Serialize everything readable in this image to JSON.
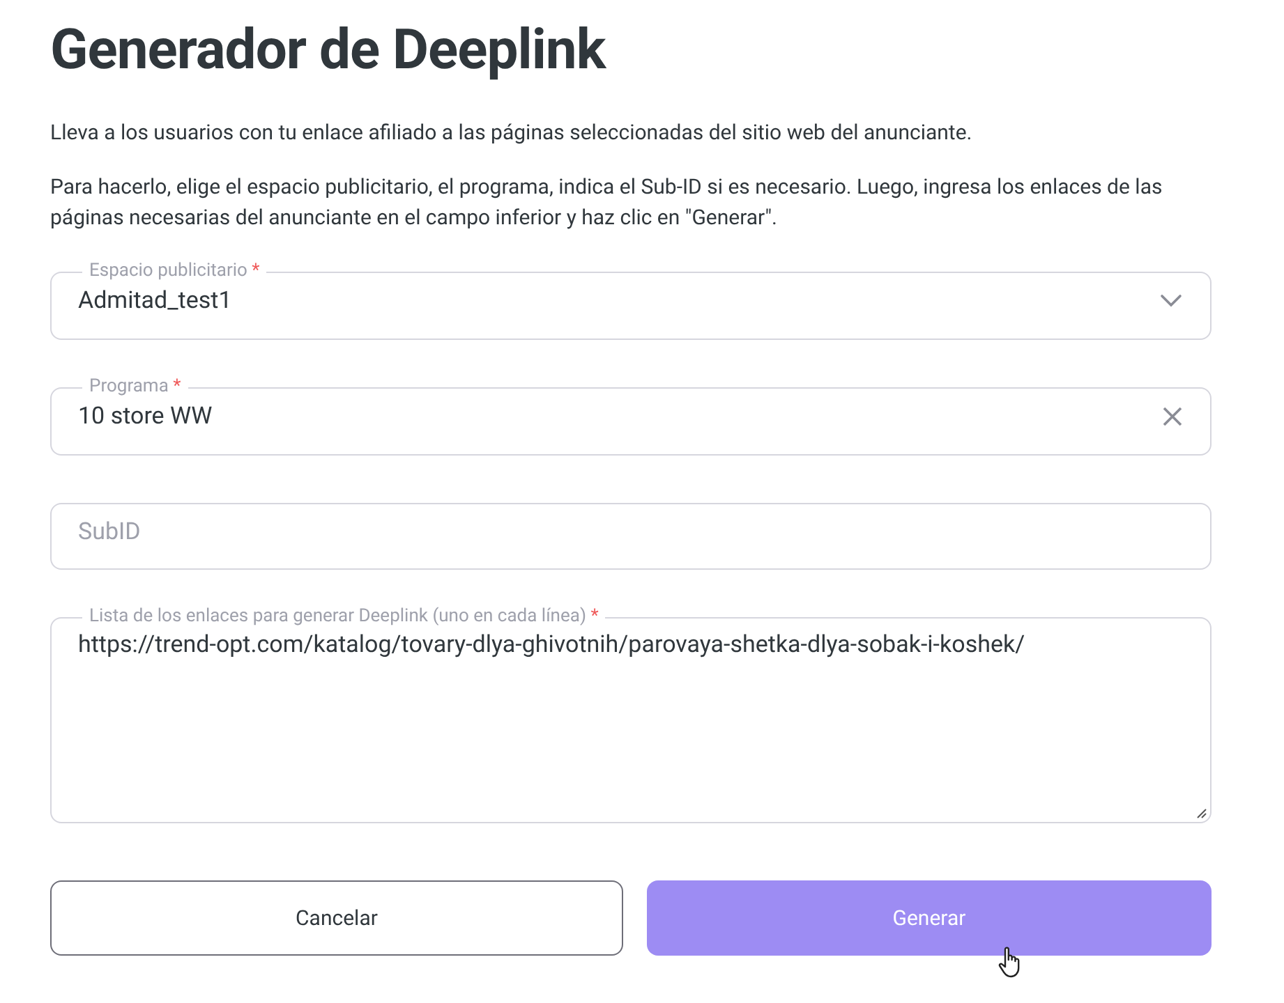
{
  "title": "Generador de Deeplink",
  "paragraphs": [
    "Lleva a los usuarios con tu enlace afiliado a las páginas seleccionadas del sitio web del anunciante.",
    "Para hacerlo, elige el espacio publicitario, el programa, indica el Sub-ID si es necesario. Luego, ingresa los enlaces de las páginas necesarias del anunciante en el campo inferior y haz clic en \"Generar\"."
  ],
  "fields": [
    {
      "kind": "select",
      "label": "Espacio publicitario",
      "required_mark": "*",
      "value": "Admitad_test1"
    },
    {
      "kind": "combobox",
      "label": "Programa",
      "required_mark": "*",
      "value": "10 store WW"
    },
    {
      "kind": "text",
      "placeholder": "SubID"
    },
    {
      "kind": "textarea",
      "label": "Lista de los enlaces para generar Deeplink (uno en cada línea)",
      "required_mark": "*",
      "value": "https://trend-opt.com/katalog/tovary-dlya-ghivotnih/parovaya-shetka-dlya-sobak-i-koshek/"
    }
  ],
  "buttons": [
    {
      "kind": "secondary",
      "label": "Cancelar",
      "disabled": false
    },
    {
      "kind": "primary",
      "label": "Generar",
      "disabled": true
    }
  ]
}
